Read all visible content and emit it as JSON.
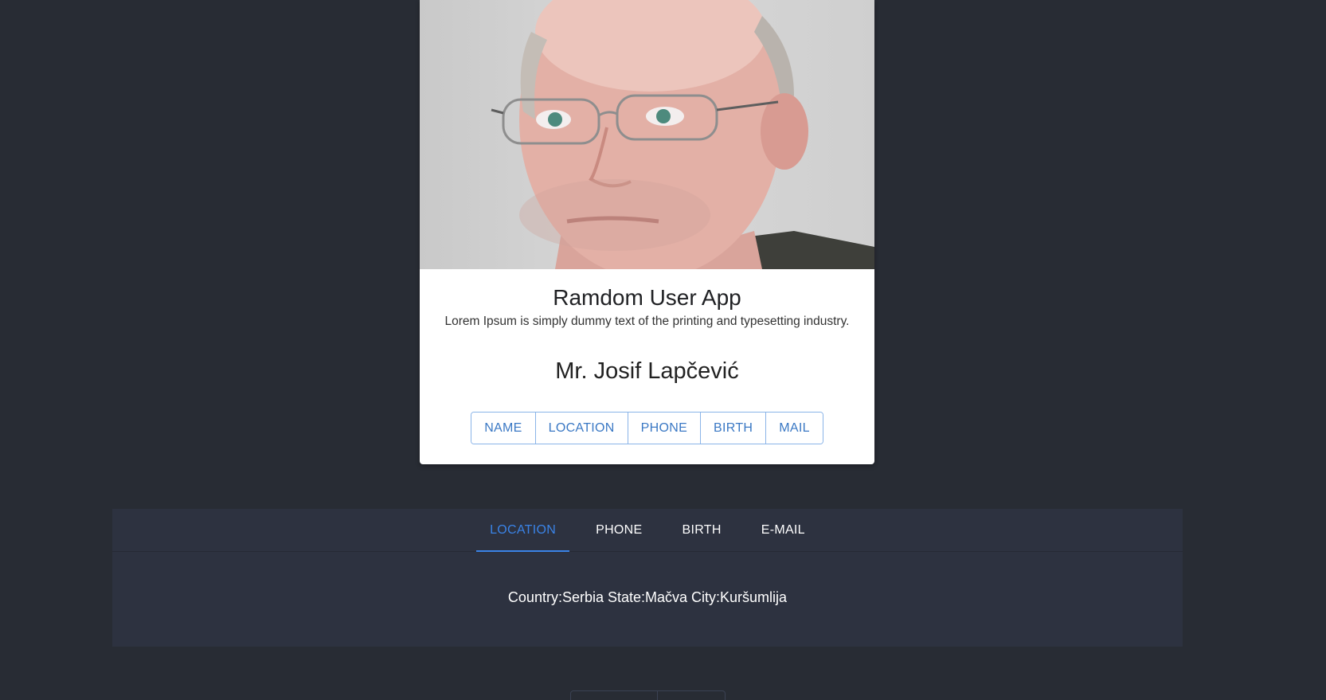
{
  "card": {
    "photo_alt": "user-portrait",
    "title": "Ramdom User App",
    "description": "Lorem Ipsum is simply dummy text of the printing and typesetting industry.",
    "user_name": "Mr. Josif Lapčević",
    "buttons": [
      {
        "label": "NAME"
      },
      {
        "label": "LOCATION"
      },
      {
        "label": "PHONE"
      },
      {
        "label": "BIRTH"
      },
      {
        "label": "MAIL"
      }
    ]
  },
  "tabs": {
    "items": [
      {
        "label": "LOCATION",
        "active": true
      },
      {
        "label": "PHONE",
        "active": false
      },
      {
        "label": "BIRTH",
        "active": false
      },
      {
        "label": "E-MAIL",
        "active": false
      }
    ],
    "content": "Country:Serbia State:Mačva City:Kuršumlija"
  },
  "pager": {
    "buttons": [
      {
        "label": ""
      },
      {
        "label": ""
      }
    ]
  },
  "colors": {
    "background": "#282c34",
    "panel": "#2d3240",
    "accent": "#3a83e6",
    "button_text": "#3a78c4"
  }
}
